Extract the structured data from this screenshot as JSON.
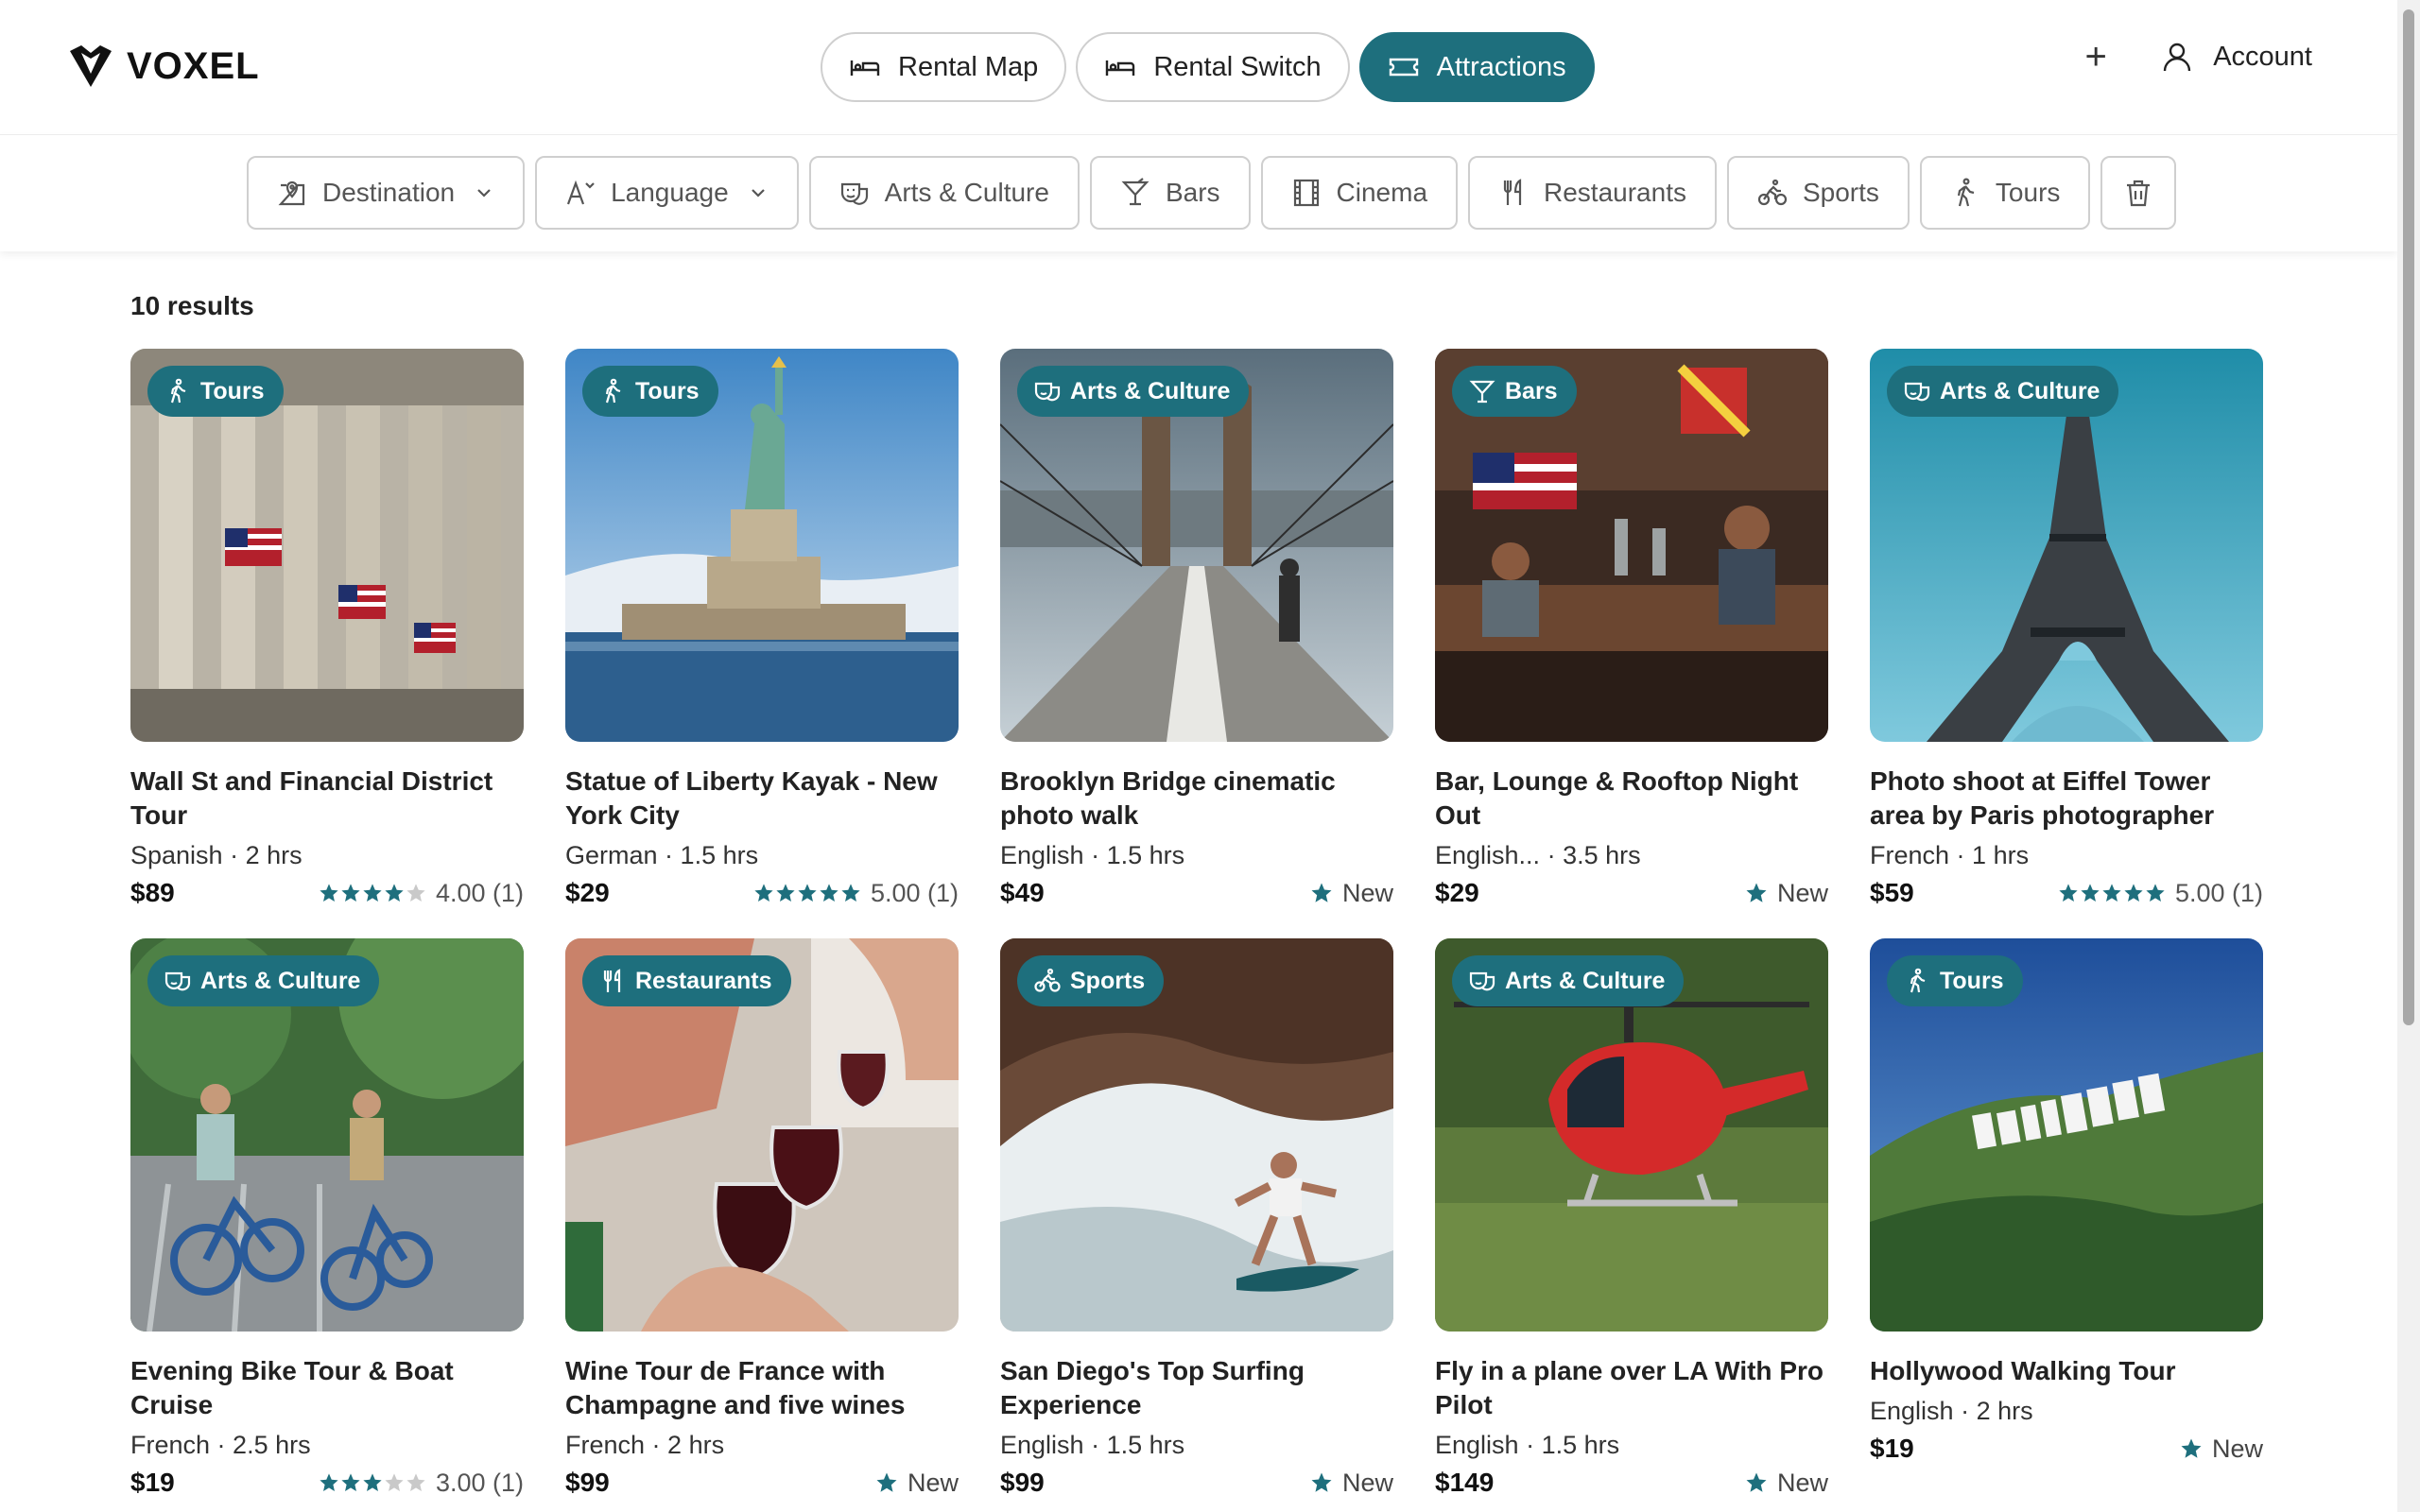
{
  "brand": {
    "name": "VOXEL"
  },
  "nav": {
    "tabs": [
      {
        "label": "Rental Map",
        "icon": "bed-icon",
        "active": false
      },
      {
        "label": "Rental Switch",
        "icon": "bed-icon",
        "active": false
      },
      {
        "label": "Attractions",
        "icon": "ticket-icon",
        "active": true
      }
    ],
    "account_label": "Account",
    "plus_glyph": "+"
  },
  "filters": [
    {
      "label": "Destination",
      "icon": "map-pin-icon",
      "dropdown": true
    },
    {
      "label": "Language",
      "icon": "language-icon",
      "dropdown": true
    },
    {
      "label": "Arts & Culture",
      "icon": "masks-icon",
      "dropdown": false
    },
    {
      "label": "Bars",
      "icon": "cocktail-icon",
      "dropdown": false
    },
    {
      "label": "Cinema",
      "icon": "film-icon",
      "dropdown": false
    },
    {
      "label": "Restaurants",
      "icon": "utensils-icon",
      "dropdown": false
    },
    {
      "label": "Sports",
      "icon": "bike-icon",
      "dropdown": false
    },
    {
      "label": "Tours",
      "icon": "walking-icon",
      "dropdown": false
    }
  ],
  "results": {
    "count_label": "10 results",
    "items": [
      {
        "category": "Tours",
        "title": "Wall St and Financial District Tour",
        "language": "Spanish",
        "duration": "2 hrs",
        "price": "$89",
        "rating": 4,
        "rating_label": "4.00 (1)",
        "is_new": false
      },
      {
        "category": "Tours",
        "title": "Statue of Liberty Kayak - New York City",
        "language": "German",
        "duration": "1.5 hrs",
        "price": "$29",
        "rating": 5,
        "rating_label": "5.00 (1)",
        "is_new": false
      },
      {
        "category": "Arts & Culture",
        "title": "Brooklyn Bridge cinematic photo walk",
        "language": "English",
        "duration": "1.5 hrs",
        "price": "$49",
        "new_label": "New",
        "is_new": true
      },
      {
        "category": "Bars",
        "title": "Bar, Lounge & Rooftop Night Out",
        "language": "English...",
        "duration": "3.5 hrs",
        "price": "$29",
        "new_label": "New",
        "is_new": true
      },
      {
        "category": "Arts & Culture",
        "title": "Photo shoot at Eiffel Tower area by Paris photographer",
        "language": "French",
        "duration": "1 hrs",
        "price": "$59",
        "rating": 5,
        "rating_label": "5.00 (1)",
        "is_new": false
      },
      {
        "category": "Arts & Culture",
        "title": "Evening Bike Tour & Boat Cruise",
        "language": "French",
        "duration": "2.5 hrs",
        "price": "$19",
        "rating": 3,
        "rating_label": "3.00 (1)",
        "is_new": false
      },
      {
        "category": "Restaurants",
        "title": "Wine Tour de France with Champagne and five wines",
        "language": "French",
        "duration": "2 hrs",
        "price": "$99",
        "new_label": "New",
        "is_new": true
      },
      {
        "category": "Sports",
        "title": "San Diego's Top Surfing Experience",
        "language": "English",
        "duration": "1.5 hrs",
        "price": "$99",
        "new_label": "New",
        "is_new": true
      },
      {
        "category": "Arts & Culture",
        "title": "Fly in a plane over LA With Pro Pilot",
        "language": "English",
        "duration": "1.5 hrs",
        "price": "$149",
        "new_label": "New",
        "is_new": true
      },
      {
        "category": "Tours",
        "title": "Hollywood Walking Tour",
        "language": "English",
        "duration": "2 hrs",
        "price": "$19",
        "new_label": "New",
        "is_new": true
      }
    ]
  },
  "colors": {
    "accent": "#1e6f7d",
    "star": "#1e6f7d",
    "star_empty": "#c9c9c9"
  }
}
